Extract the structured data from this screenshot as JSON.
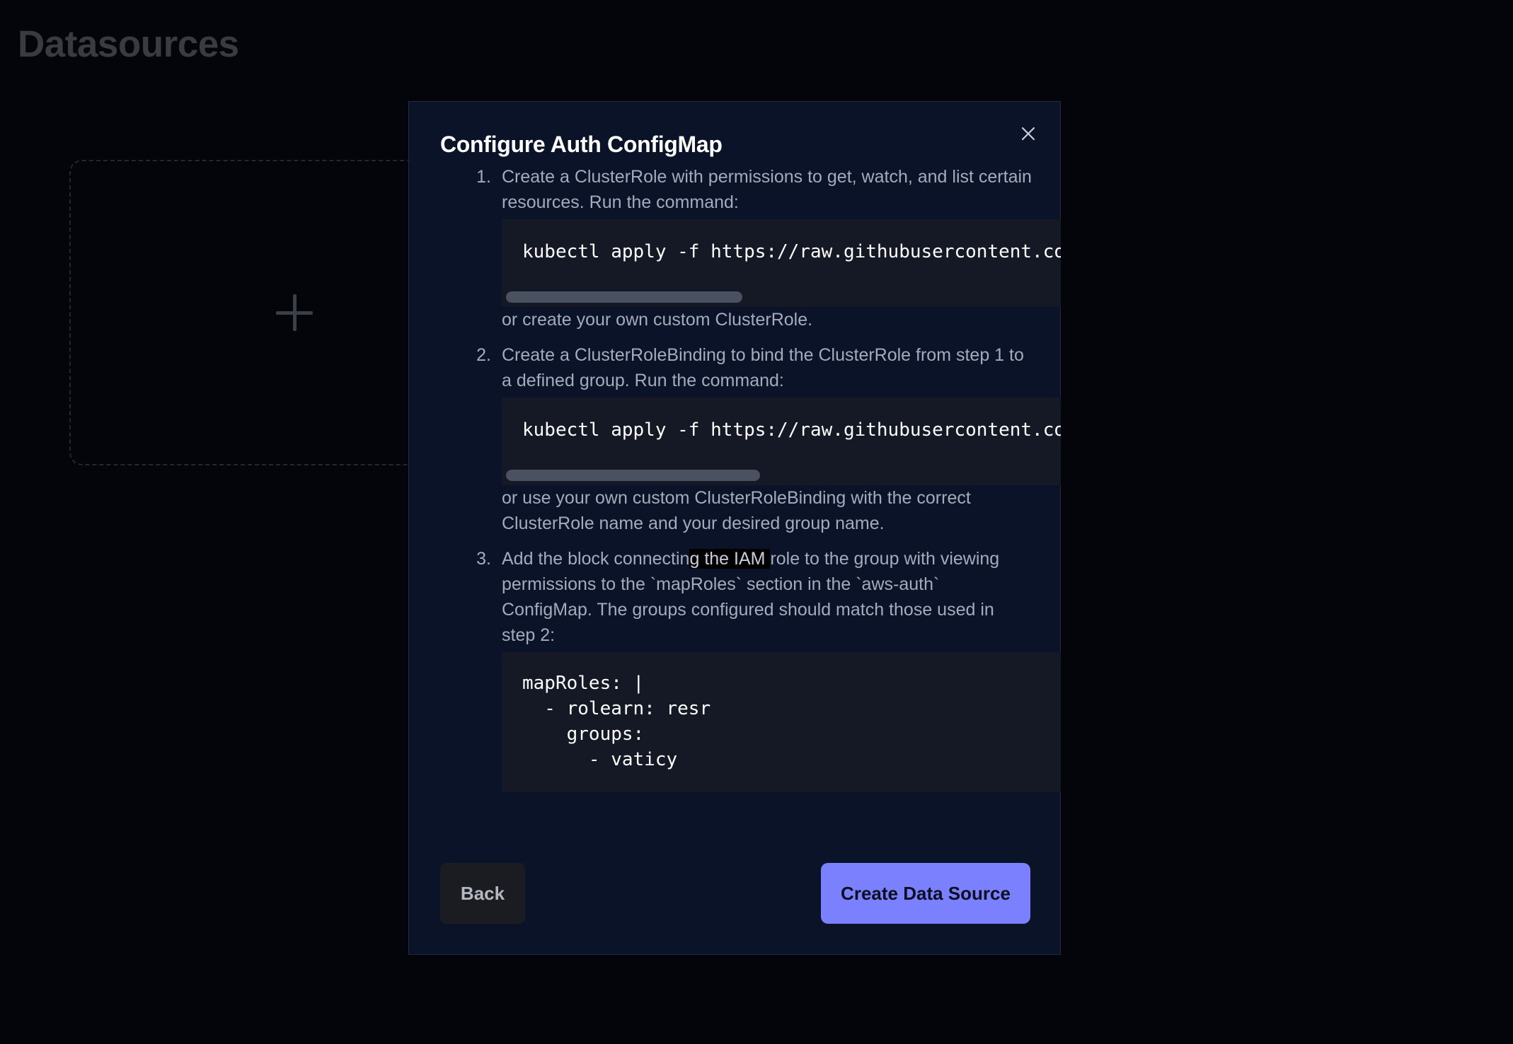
{
  "page": {
    "title": "Datasources"
  },
  "add_card": {
    "icon": "plus-icon"
  },
  "modal": {
    "title": "Configure Auth ConfigMap",
    "close_icon": "close-icon",
    "steps": [
      {
        "number": "1.",
        "text": "Create a ClusterRole with permissions to get, watch, and list certain resources. Run the command:",
        "code": "kubectl apply -f https://raw.githubusercontent.com/",
        "after": "or create your own custom ClusterRole."
      },
      {
        "number": "2.",
        "text": "Create a ClusterRoleBinding to bind the ClusterRole from step 1 to a defined group. Run the command:",
        "code": "kubectl apply -f https://raw.githubusercontent.com/",
        "after": "or use your own custom ClusterRoleBinding with the correct ClusterRole name and your desired group name."
      },
      {
        "number": "3.",
        "text_before_highlight": "Add the block connectin",
        "text_highlight": "g the IAM ",
        "text_after_highlight": "role to the group with viewing permissions to the `mapRoles` section in the `aws-auth` ConfigMap. The groups configured should match those used in step 2:",
        "code": "mapRoles: |\n  - rolearn: resr\n    groups:\n      - vaticy"
      }
    ],
    "buttons": {
      "back": "Back",
      "create": "Create Data Source"
    }
  },
  "colors": {
    "background": "#04050a",
    "modal_bg": "#0b1328",
    "code_bg": "#141925",
    "primary_button": "#7b80ff",
    "secondary_button": "#1a1c22"
  }
}
